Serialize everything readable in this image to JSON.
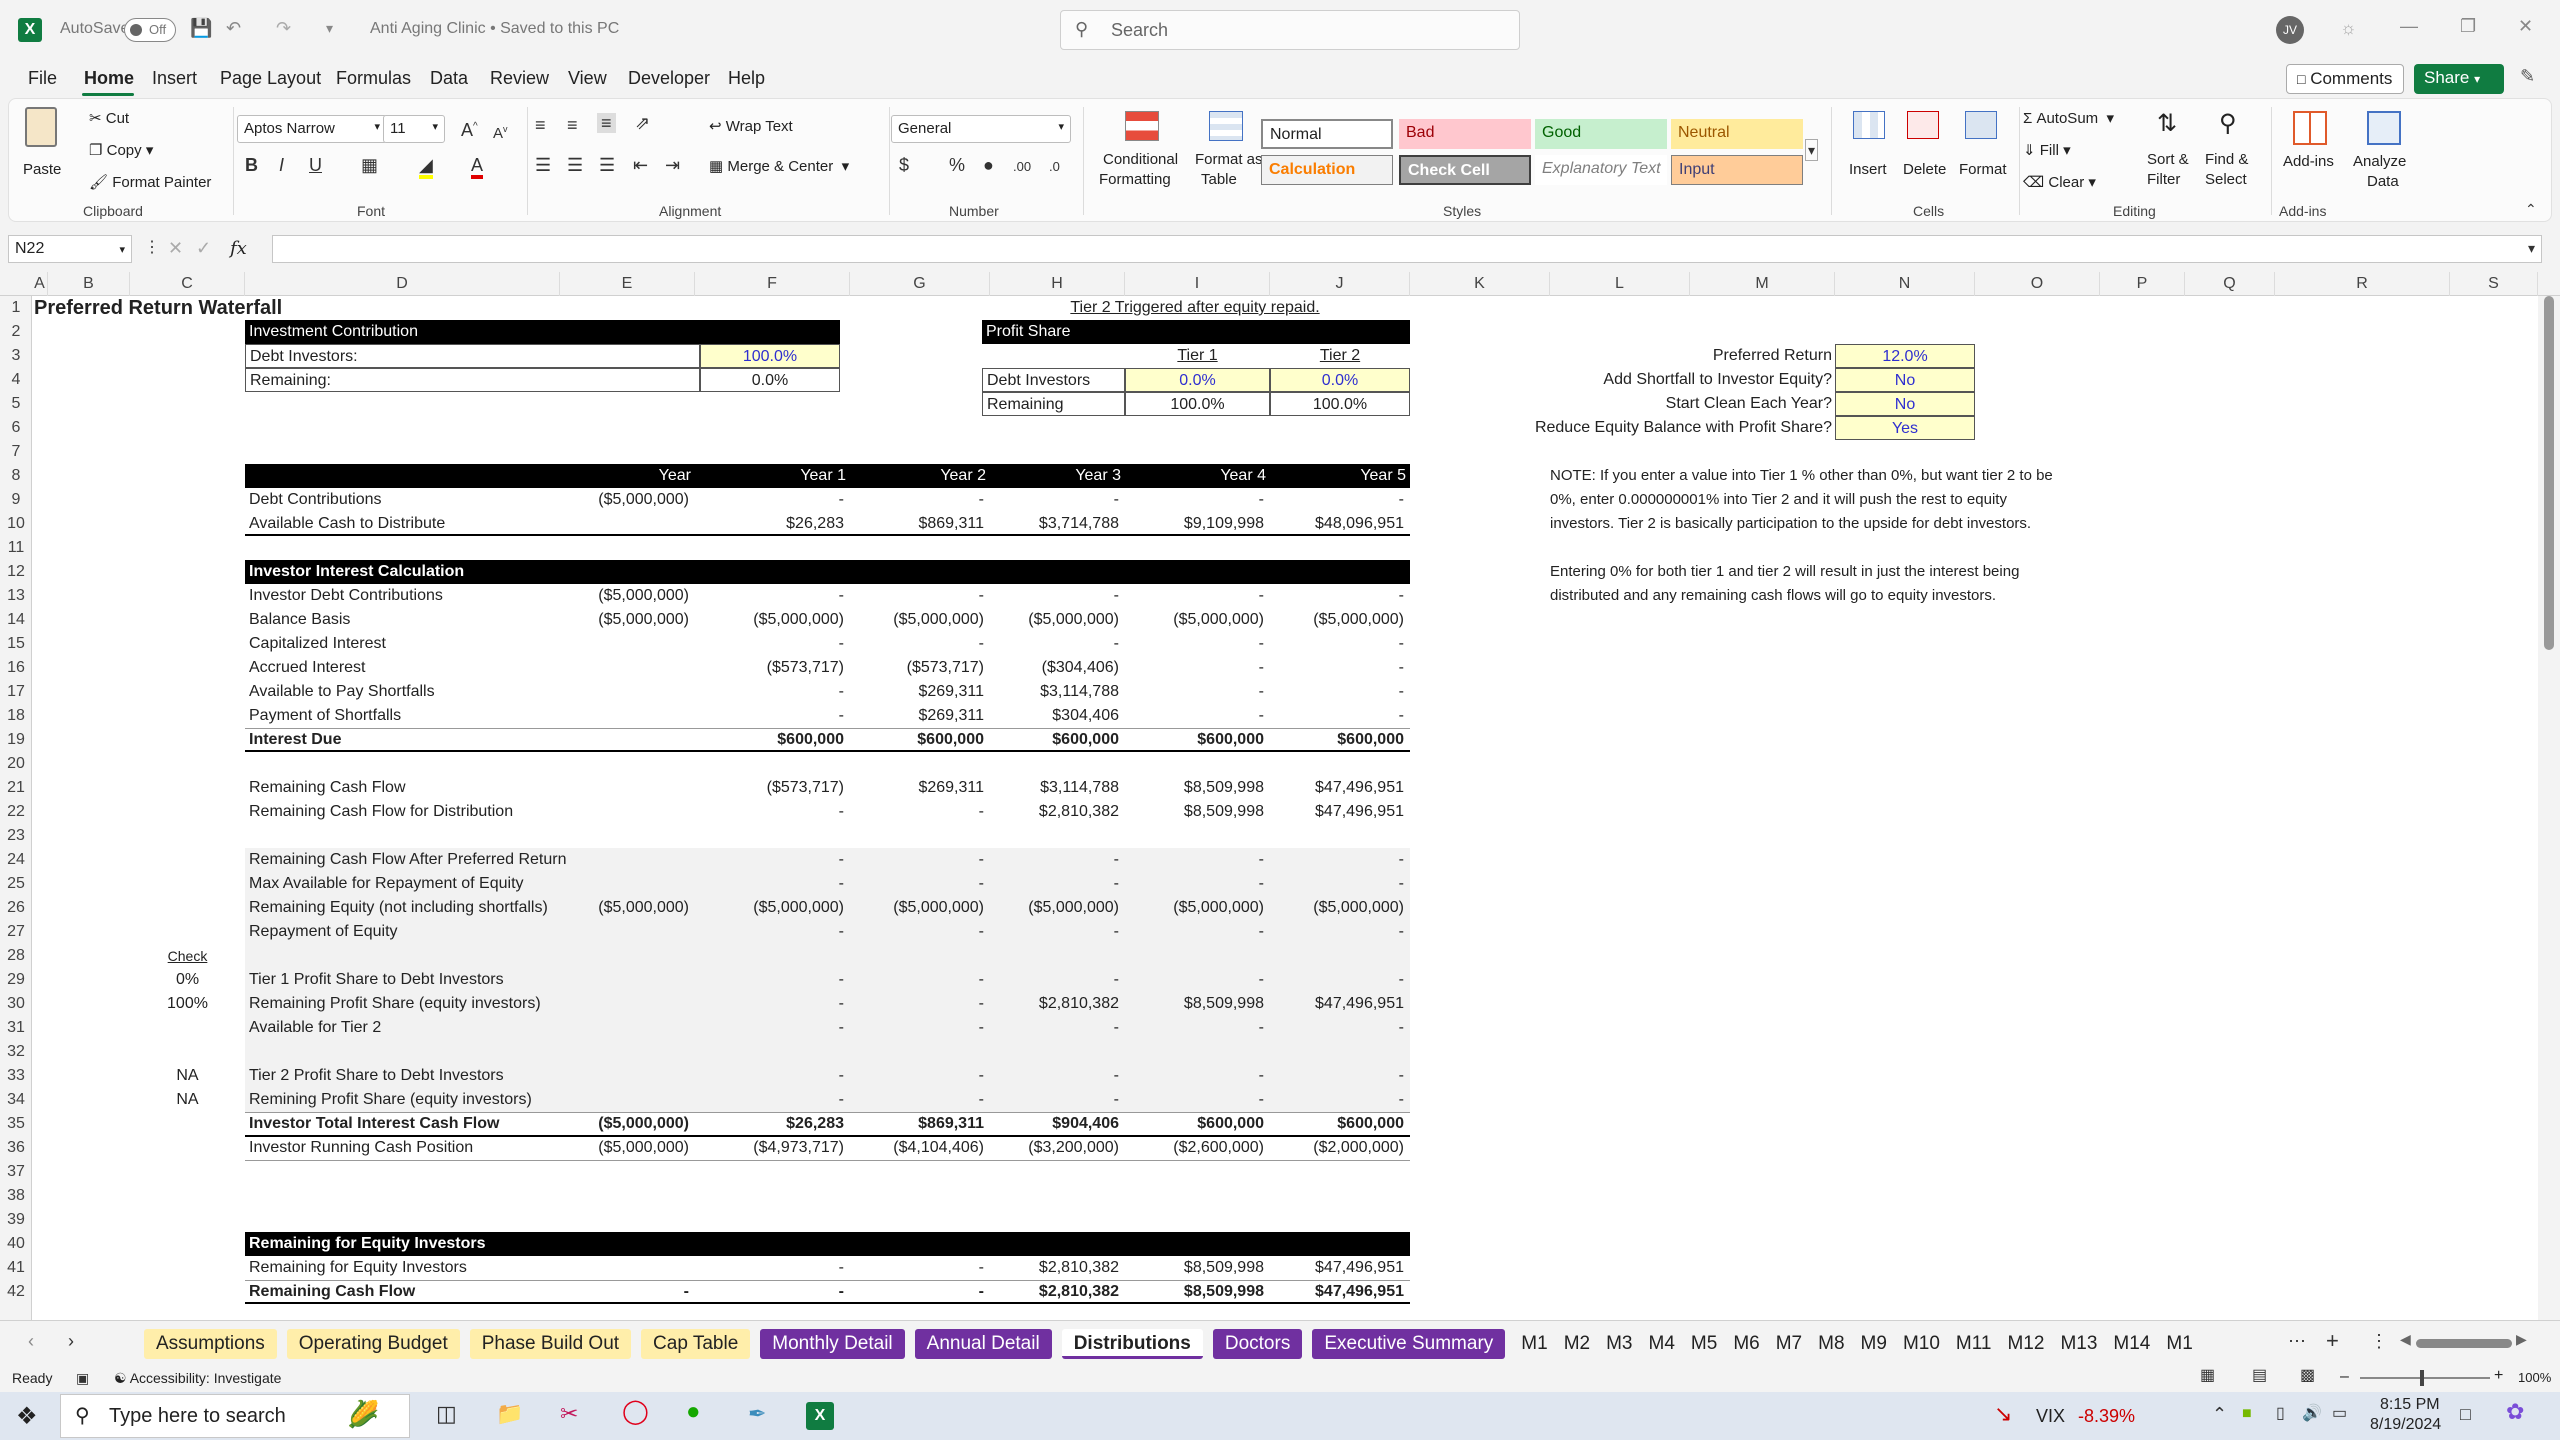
{
  "app": {
    "autosave_label": "AutoSave",
    "autosave_state": "Off",
    "title": "Anti Aging Clinic • Saved to this PC",
    "search_placeholder": "Search",
    "user_initials": "JV"
  },
  "menu": [
    "File",
    "Home",
    "Insert",
    "Page Layout",
    "Formulas",
    "Data",
    "Review",
    "View",
    "Developer",
    "Help"
  ],
  "menu_right": {
    "comments": "Comments",
    "share": "Share"
  },
  "ribbon": {
    "clipboard": {
      "paste": "Paste",
      "cut": "Cut",
      "copy": "Copy",
      "format_painter": "Format Painter",
      "group": "Clipboard"
    },
    "font": {
      "name": "Aptos Narrow",
      "size": "11",
      "group": "Font"
    },
    "alignment": {
      "wrap": "Wrap Text",
      "merge": "Merge & Center",
      "group": "Alignment"
    },
    "number": {
      "format": "General",
      "group": "Number"
    },
    "styles": {
      "cond": "Conditional",
      "cond2": "Formatting",
      "fmt_table": "Format as",
      "fmt_table2": "Table",
      "normal": "Normal",
      "bad": "Bad",
      "good": "Good",
      "neutral": "Neutral",
      "calculation": "Calculation",
      "check_cell": "Check Cell",
      "explanatory": "Explanatory Text",
      "input": "Input",
      "group": "Styles"
    },
    "cells": {
      "insert": "Insert",
      "delete": "Delete",
      "format": "Format",
      "group": "Cells"
    },
    "editing": {
      "autosum": "AutoSum",
      "fill": "Fill",
      "clear": "Clear",
      "sort": "Sort &",
      "sort2": "Filter",
      "find": "Find &",
      "find2": "Select",
      "group": "Editing"
    },
    "addins": {
      "addins": "Add-ins",
      "analyze": "Analyze",
      "analyze2": "Data",
      "group": "Add-ins"
    }
  },
  "formula_bar": {
    "name_box": "N22",
    "fx": "fx",
    "content": ""
  },
  "columns": [
    "A",
    "B",
    "C",
    "D",
    "E",
    "F",
    "G",
    "H",
    "I",
    "J",
    "K",
    "L",
    "M",
    "N",
    "O",
    "P",
    "Q",
    "R",
    "S"
  ],
  "rows": [
    "1",
    "2",
    "3",
    "4",
    "5",
    "6",
    "7",
    "8",
    "9",
    "10",
    "11",
    "12",
    "13",
    "14",
    "15",
    "16",
    "17",
    "18",
    "19",
    "20",
    "21",
    "22",
    "23",
    "24",
    "25",
    "26",
    "27",
    "28",
    "29",
    "30",
    "31",
    "32",
    "33",
    "34",
    "35",
    "36",
    "37",
    "38",
    "39",
    "40",
    "41",
    "42"
  ],
  "sheet": {
    "title": "Preferred Return Waterfall",
    "invest_hdr": "Investment Contribution",
    "debt_investors": "Debt Investors:",
    "debt_investors_val": "100.0%",
    "remaining": "Remaining:",
    "remaining_val": "0.0%",
    "tier2_note": "Tier 2 Triggered after equity repaid.",
    "profit_share": "Profit Share",
    "tier1": "Tier 1",
    "tier2": "Tier 2",
    "ps_debt": "Debt Investors",
    "ps_debt_t1": "0.0%",
    "ps_debt_t2": "0.0%",
    "ps_rem": "Remaining",
    "ps_rem_t1": "100.0%",
    "ps_rem_t2": "100.0%",
    "pref_return": "Preferred Return",
    "pref_return_val": "12.0%",
    "add_shortfall": "Add Shortfall to Investor Equity?",
    "add_shortfall_val": "No",
    "start_clean": "Start Clean Each Year?",
    "start_clean_val": "No",
    "reduce_equity": "Reduce Equity Balance with Profit Share?",
    "reduce_equity_val": "Yes",
    "note1": "NOTE: If you enter a value into Tier 1 % other than 0%, but want tier 2 to be",
    "note2": "0%, enter 0.000000001% into Tier 2 and it will push the rest to equity",
    "note3": "investors. Tier 2 is basically participation to the upside for debt investors.",
    "note4": "Entering 0% for both tier 1 and tier 2 will result in just the interest being",
    "note5": "distributed and any remaining cash flows will go to equity investors.",
    "years": [
      "Year",
      "Year 1",
      "Year 2",
      "Year 3",
      "Year 4",
      "Year 5"
    ],
    "check": "Check",
    "check29": "0%",
    "check30": "100%",
    "check33": "NA",
    "check34": "NA",
    "rows": [
      {
        "r": 9,
        "label": "Debt Contributions",
        "v": [
          "($5,000,000)",
          "-",
          "-",
          "-",
          "-",
          "-"
        ]
      },
      {
        "r": 10,
        "label": "Available Cash to Distribute",
        "v": [
          "",
          "$26,283",
          "$869,311",
          "$3,714,788",
          "$9,109,998",
          "$48,096,951"
        ]
      },
      {
        "r": 12,
        "label": "Investor Interest Calculation",
        "v": [
          "",
          "",
          "",
          "",
          "",
          ""
        ],
        "hdr": true
      },
      {
        "r": 13,
        "label": "Investor Debt Contributions",
        "v": [
          "($5,000,000)",
          "-",
          "-",
          "-",
          "-",
          "-"
        ]
      },
      {
        "r": 14,
        "label": "Balance Basis",
        "v": [
          "($5,000,000)",
          "($5,000,000)",
          "($5,000,000)",
          "($5,000,000)",
          "($5,000,000)",
          "($5,000,000)"
        ]
      },
      {
        "r": 15,
        "label": "Capitalized Interest",
        "v": [
          "",
          "-",
          "-",
          "-",
          "-",
          "-"
        ]
      },
      {
        "r": 16,
        "label": "Accrued Interest",
        "v": [
          "",
          "($573,717)",
          "($573,717)",
          "($304,406)",
          "-",
          "-"
        ]
      },
      {
        "r": 17,
        "label": "Available to Pay Shortfalls",
        "v": [
          "",
          "-",
          "$269,311",
          "$3,114,788",
          "-",
          "-"
        ]
      },
      {
        "r": 18,
        "label": "Payment of Shortfalls",
        "v": [
          "",
          "-",
          "$269,311",
          "$304,406",
          "-",
          "-"
        ]
      },
      {
        "r": 19,
        "label": "Interest Due",
        "v": [
          "",
          "$600,000",
          "$600,000",
          "$600,000",
          "$600,000",
          "$600,000"
        ],
        "bold": true
      },
      {
        "r": 21,
        "label": "Remaining Cash Flow",
        "v": [
          "",
          "($573,717)",
          "$269,311",
          "$3,114,788",
          "$8,509,998",
          "$47,496,951"
        ]
      },
      {
        "r": 22,
        "label": "Remaining Cash Flow for Distribution",
        "v": [
          "",
          "-",
          "-",
          "$2,810,382",
          "$8,509,998",
          "$47,496,951"
        ]
      },
      {
        "r": 24,
        "label": "Remaining Cash Flow After Preferred Return",
        "v": [
          "",
          "-",
          "-",
          "-",
          "-",
          "-"
        ]
      },
      {
        "r": 25,
        "label": "Max Available for Repayment of Equity",
        "v": [
          "",
          "-",
          "-",
          "-",
          "-",
          "-"
        ]
      },
      {
        "r": 26,
        "label": "Remaining Equity (not including shortfalls)",
        "v": [
          "($5,000,000)",
          "($5,000,000)",
          "($5,000,000)",
          "($5,000,000)",
          "($5,000,000)",
          "($5,000,000)"
        ]
      },
      {
        "r": 27,
        "label": "Repayment of Equity",
        "v": [
          "",
          "-",
          "-",
          "-",
          "-",
          "-"
        ]
      },
      {
        "r": 29,
        "label": "Tier 1 Profit Share to Debt Investors",
        "v": [
          "",
          "-",
          "-",
          "-",
          "-",
          "-"
        ]
      },
      {
        "r": 30,
        "label": "Remaining Profit Share (equity investors)",
        "v": [
          "",
          "-",
          "-",
          "$2,810,382",
          "$8,509,998",
          "$47,496,951"
        ]
      },
      {
        "r": 31,
        "label": "Available for Tier 2",
        "v": [
          "",
          "-",
          "-",
          "-",
          "-",
          "-"
        ]
      },
      {
        "r": 33,
        "label": "Tier 2 Profit Share to Debt Investors",
        "v": [
          "",
          "-",
          "-",
          "-",
          "-",
          "-"
        ]
      },
      {
        "r": 34,
        "label": "Remining Profit Share (equity investors)",
        "v": [
          "",
          "-",
          "-",
          "-",
          "-",
          "-"
        ]
      },
      {
        "r": 35,
        "label": "Investor Total Interest Cash Flow",
        "v": [
          "($5,000,000)",
          "$26,283",
          "$869,311",
          "$904,406",
          "$600,000",
          "$600,000"
        ],
        "bold": true
      },
      {
        "r": 36,
        "label": "Investor Running Cash Position",
        "v": [
          "($5,000,000)",
          "($4,973,717)",
          "($4,104,406)",
          "($3,200,000)",
          "($2,600,000)",
          "($2,000,000)"
        ]
      },
      {
        "r": 40,
        "label": "Remaining for Equity Investors",
        "v": [
          "",
          "",
          "",
          "",
          "",
          ""
        ],
        "hdr": true
      },
      {
        "r": 41,
        "label": "Remaining for Equity Investors",
        "v": [
          "",
          "-",
          "-",
          "$2,810,382",
          "$8,509,998",
          "$47,496,951"
        ]
      },
      {
        "r": 42,
        "label": "Remaining Cash Flow",
        "v": [
          "-",
          "-",
          "-",
          "$2,810,382",
          "$8,509,998",
          "$47,496,951"
        ],
        "bold": true
      }
    ]
  },
  "tabs": [
    {
      "label": "Assumptions",
      "style": "yel"
    },
    {
      "label": "Operating Budget",
      "style": "yel"
    },
    {
      "label": "Phase Build Out",
      "style": "yel"
    },
    {
      "label": "Cap Table",
      "style": "yel"
    },
    {
      "label": "Monthly Detail",
      "style": "pur"
    },
    {
      "label": "Annual Detail",
      "style": "pur"
    },
    {
      "label": "Distributions",
      "style": "act"
    },
    {
      "label": "Doctors",
      "style": "pur"
    },
    {
      "label": "Executive Summary",
      "style": "pur"
    },
    {
      "label": "M1",
      "style": "plain"
    },
    {
      "label": "M2",
      "style": "plain"
    },
    {
      "label": "M3",
      "style": "plain"
    },
    {
      "label": "M4",
      "style": "plain"
    },
    {
      "label": "M5",
      "style": "plain"
    },
    {
      "label": "M6",
      "style": "plain"
    },
    {
      "label": "M7",
      "style": "plain"
    },
    {
      "label": "M8",
      "style": "plain"
    },
    {
      "label": "M9",
      "style": "plain"
    },
    {
      "label": "M10",
      "style": "plain"
    },
    {
      "label": "M11",
      "style": "plain"
    },
    {
      "label": "M12",
      "style": "plain"
    },
    {
      "label": "M13",
      "style": "plain"
    },
    {
      "label": "M14",
      "style": "plain"
    },
    {
      "label": "M1",
      "style": "plain"
    }
  ],
  "status": {
    "ready": "Ready",
    "accessibility": "Accessibility: Investigate",
    "zoom": "100%"
  },
  "taskbar": {
    "search": "Type here to search",
    "vix_label": "VIX",
    "vix_val": "-8.39%",
    "time": "8:15 PM",
    "date": "8/19/2024"
  }
}
